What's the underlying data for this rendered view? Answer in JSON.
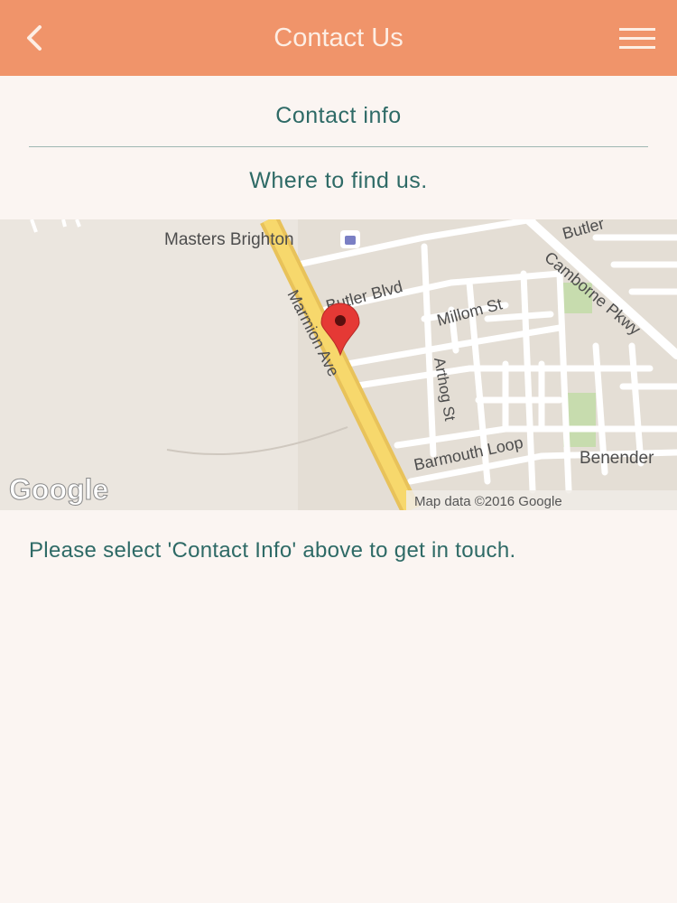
{
  "header": {
    "title": "Contact Us",
    "back_icon": "chevron-left-icon",
    "menu_icon": "hamburger-menu-icon",
    "background_color": "#f0946a"
  },
  "links": {
    "contact_info": "Contact info",
    "where_to_find": "Where to find us."
  },
  "map": {
    "place_label": "Masters Brighton",
    "streets": {
      "marmion_ave": "Marmion Ave",
      "butler_blvd": "Butler Blvd",
      "butler_top": "Butler",
      "millom_st": "Millom St",
      "camborne_pkwy": "Camborne Pkwy",
      "arthog_st": "Arthog St",
      "barmouth_loop": "Barmouth Loop",
      "benender": "Benender"
    },
    "logo": "Google",
    "attribution": "Map data ©2016 Google",
    "pin_color": "#e53935"
  },
  "message": "Please select 'Contact Info' above to get in touch.",
  "colors": {
    "accent_text": "#2e6a66",
    "page_background": "#fbf5f2"
  }
}
